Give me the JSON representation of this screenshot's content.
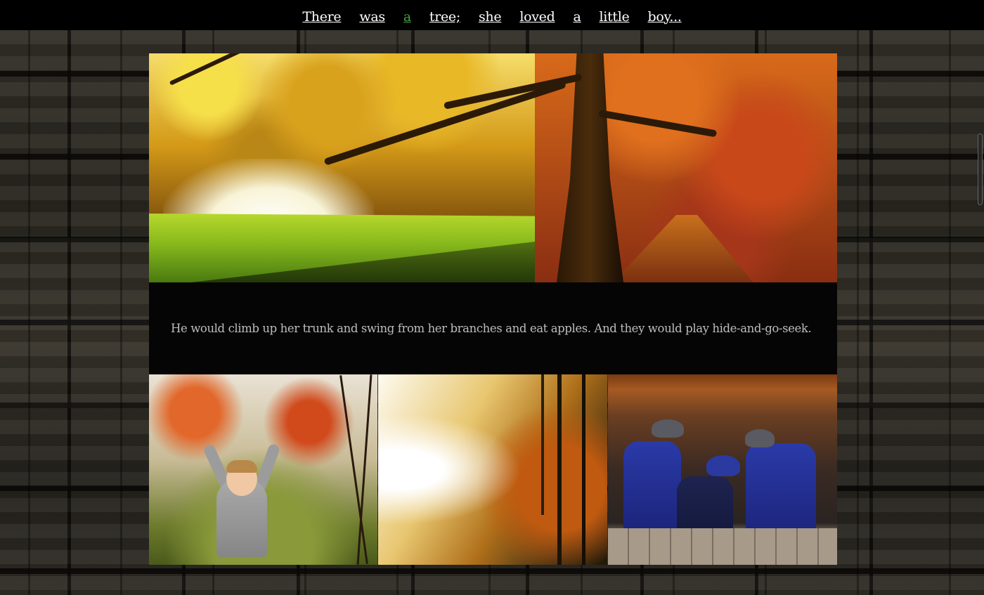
{
  "nav": {
    "words": [
      "There",
      "was",
      "a",
      "tree;",
      "she",
      "loved",
      "a",
      "little",
      "boy..."
    ],
    "active_index": 2,
    "active_color": "#3fa43f",
    "text_color": "#ffffff"
  },
  "caption": {
    "text": "He would climb up her trunk and swing from her branches and eat apples. And they would play hide-and-go-seek."
  },
  "colors": {
    "topbar_bg": "#000000",
    "caption_bg": "#050505",
    "caption_text": "#bdbdbd"
  }
}
